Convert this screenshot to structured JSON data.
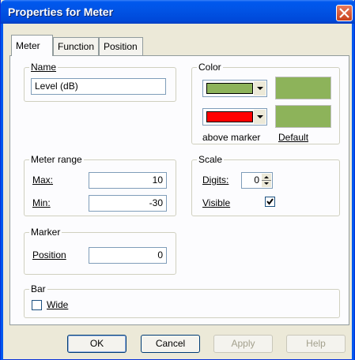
{
  "window": {
    "title": "Properties for Meter"
  },
  "tabs": [
    {
      "label": "Meter",
      "active": true
    },
    {
      "label": "Function",
      "active": false
    },
    {
      "label": "Position",
      "active": false
    }
  ],
  "name_group": {
    "legend": "Name",
    "value": "Level (dB)"
  },
  "color_group": {
    "legend": "Color",
    "meter_color": "#8db35a",
    "marker_color": "#ff0000",
    "above_marker_label": "above marker",
    "default_label": "Default"
  },
  "range_group": {
    "legend": "Meter range",
    "max_label": "Max:",
    "max_value": "10",
    "min_label": "Min:",
    "min_value": "-30"
  },
  "scale_group": {
    "legend": "Scale",
    "digits_label": "Digits:",
    "digits_value": "0",
    "visible_label": "Visible",
    "visible_checked": true
  },
  "marker_group": {
    "legend": "Marker",
    "position_label": "Position",
    "position_value": "0"
  },
  "bar_group": {
    "legend": "Bar",
    "wide_label": "Wide",
    "wide_checked": false
  },
  "buttons": {
    "ok": "OK",
    "cancel": "Cancel",
    "apply": "Apply",
    "help": "Help"
  }
}
